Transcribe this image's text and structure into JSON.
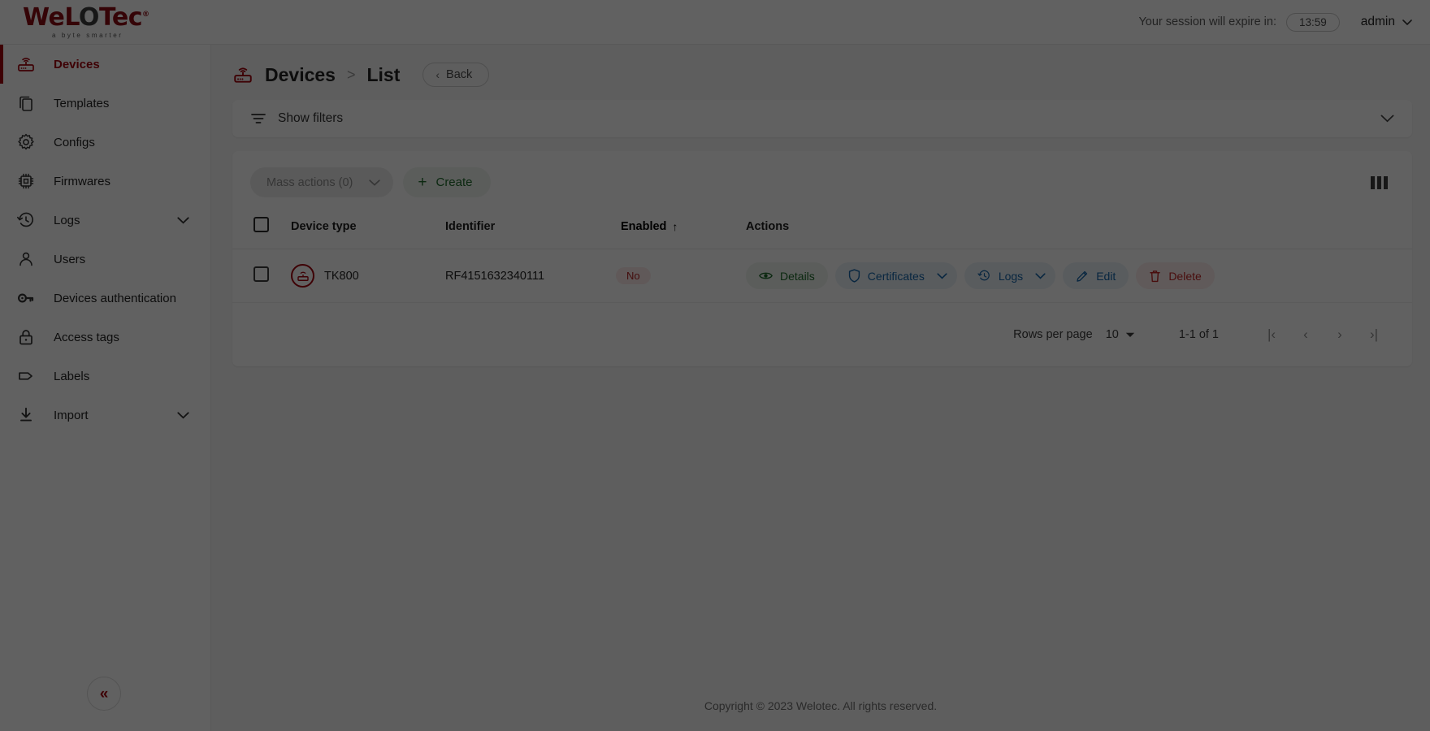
{
  "header": {
    "logo_main_a": "WeL",
    "logo_main_b": "O",
    "logo_main_c": "Tec",
    "logo_reg": "®",
    "logo_sub": "a byte smarter",
    "session_label": "Your session will expire in:",
    "session_timer": "13:59",
    "user_name": "admin"
  },
  "sidebar": {
    "items": [
      {
        "label": "Devices",
        "icon": "router-icon",
        "active": true,
        "expandable": false
      },
      {
        "label": "Templates",
        "icon": "copy-icon",
        "active": false,
        "expandable": false
      },
      {
        "label": "Configs",
        "icon": "gear-icon",
        "active": false,
        "expandable": false
      },
      {
        "label": "Firmwares",
        "icon": "chip-icon",
        "active": false,
        "expandable": false
      },
      {
        "label": "Logs",
        "icon": "history-icon",
        "active": false,
        "expandable": true
      },
      {
        "label": "Users",
        "icon": "user-icon",
        "active": false,
        "expandable": false
      },
      {
        "label": "Devices authentication",
        "icon": "key-icon",
        "active": false,
        "expandable": false
      },
      {
        "label": "Access tags",
        "icon": "lock-icon",
        "active": false,
        "expandable": false
      },
      {
        "label": "Labels",
        "icon": "tag-icon",
        "active": false,
        "expandable": false
      },
      {
        "label": "Import",
        "icon": "download-icon",
        "active": false,
        "expandable": true
      }
    ],
    "collapse_glyph": "«"
  },
  "breadcrumb": {
    "root": "Devices",
    "separator": ">",
    "current": "List",
    "back_label": "Back",
    "back_glyph": "‹"
  },
  "filters": {
    "label": "Show filters"
  },
  "toolbar": {
    "mass_actions_label": "Mass actions (0)",
    "create_label": "Create",
    "create_plus": "+",
    "columns_icon": "columns-icon"
  },
  "table": {
    "headers": {
      "device_type": "Device type",
      "identifier": "Identifier",
      "enabled": "Enabled",
      "sort_arrow": "↑",
      "actions": "Actions"
    },
    "rows": [
      {
        "device_type": "TK800",
        "identifier": "RF4151632340111",
        "enabled": "No",
        "actions": [
          {
            "label": "Details",
            "icon": "eye-icon",
            "style": "details",
            "caret": false
          },
          {
            "label": "Certificates",
            "icon": "shield-icon",
            "style": "cert",
            "caret": true
          },
          {
            "label": "Logs",
            "icon": "history-icon",
            "style": "logs",
            "caret": true
          },
          {
            "label": "Edit",
            "icon": "pencil-icon",
            "style": "edit",
            "caret": false
          },
          {
            "label": "Delete",
            "icon": "trash-icon",
            "style": "delete",
            "caret": false
          }
        ]
      }
    ]
  },
  "pagination": {
    "rows_per_page_label": "Rows per page",
    "rows_per_page_value": "10",
    "range": "1-1 of 1",
    "first_glyph": "|‹",
    "prev_glyph": "‹",
    "next_glyph": "›",
    "last_glyph": "›|"
  },
  "footer": {
    "copyright": "Copyright © 2023 Welotec. All rights reserved."
  },
  "colors": {
    "brand_red": "#a3050e",
    "green": "#1e6b2a",
    "blue": "#1565a8",
    "danger": "#c02626"
  }
}
